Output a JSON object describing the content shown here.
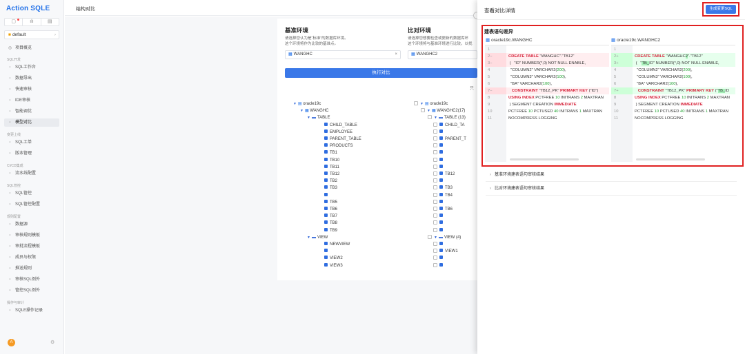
{
  "app": {
    "brand": "Action SQLE"
  },
  "header": {
    "title": "结构对比"
  },
  "sidebar": {
    "toptabs": [
      "▢",
      "ılı",
      "▤"
    ],
    "datasource": "default",
    "sections": [
      {
        "label": "SQL开发",
        "items": [
          {
            "label": "SQL工作台",
            "icon": "terminal-icon"
          },
          {
            "label": "数据导出",
            "icon": "export-icon"
          },
          {
            "label": "快速审核",
            "icon": "audit-icon"
          },
          {
            "label": "IDE审核",
            "icon": "ide-icon"
          },
          {
            "label": "智能调优",
            "icon": "tune-icon"
          },
          {
            "label": "模型对比",
            "icon": "compare-icon",
            "active": true
          }
        ]
      },
      {
        "label": "变更上线",
        "items": [
          {
            "label": "SQL工单",
            "icon": "ticket-icon"
          },
          {
            "label": "版本管理",
            "icon": "version-icon"
          }
        ]
      },
      {
        "label": "CI/CD集成",
        "items": [
          {
            "label": "流水线配置",
            "icon": "pipeline-icon"
          }
        ]
      },
      {
        "label": "SQL管控",
        "items": [
          {
            "label": "SQL管控",
            "icon": "control-icon"
          },
          {
            "label": "SQL管控配置",
            "icon": "config-icon"
          }
        ]
      },
      {
        "label": "规则配置",
        "items": [
          {
            "label": "数据源",
            "icon": "database-icon"
          },
          {
            "label": "审核规则模板",
            "icon": "rule-icon"
          },
          {
            "label": "审批流程模板",
            "icon": "flow-icon"
          },
          {
            "label": "成员与权限",
            "icon": "member-icon"
          },
          {
            "label": "推送规则",
            "icon": "push-icon"
          },
          {
            "label": "审核SQL例外",
            "icon": "exception-icon"
          },
          {
            "label": "管控SQL例外",
            "icon": "shield-icon"
          }
        ]
      },
      {
        "label": "操作与审计",
        "items": [
          {
            "label": "SQLE操作记录",
            "icon": "record-icon"
          }
        ]
      }
    ],
    "avatar": "A"
  },
  "main": {
    "base": {
      "title": "基准环境",
      "desc1": "请选择您认为是“标准”的数据库环境。",
      "desc2": "这个环境将作为比较的基准点。",
      "value": "WANGHC",
      "clear": "×"
    },
    "compare": {
      "title": "比对环境",
      "desc1": "请选择您想要检查或更新的数据库环",
      "desc2": "这个环境将与基准环境进行比较，以找",
      "value": "WANGHC2"
    },
    "run_label": "执行对比",
    "filter": "只",
    "tree_left": [
      {
        "text": "oracle19c",
        "kind": "inst"
      },
      {
        "text": "WANGHC",
        "kind": "db"
      },
      {
        "text": "TABLE",
        "kind": "folder"
      },
      {
        "text": "CHILD_TABLE",
        "kind": "t"
      },
      {
        "text": "EMPLOYEE",
        "kind": "t"
      },
      {
        "text": "PARENT_TABLE",
        "kind": "t"
      },
      {
        "text": "PRODUCTS",
        "kind": "t"
      },
      {
        "text": "TB1",
        "kind": "t"
      },
      {
        "text": "TB10",
        "kind": "t"
      },
      {
        "text": "TB11",
        "kind": "t"
      },
      {
        "text": "TB12",
        "kind": "t"
      },
      {
        "text": "TB2",
        "kind": "t"
      },
      {
        "text": "TB3",
        "kind": "t"
      },
      {
        "text": "",
        "kind": "t"
      },
      {
        "text": "TB5",
        "kind": "t"
      },
      {
        "text": "TB6",
        "kind": "t"
      },
      {
        "text": "TB7",
        "kind": "t"
      },
      {
        "text": "TB8",
        "kind": "t"
      },
      {
        "text": "TB9",
        "kind": "t"
      },
      {
        "text": "VIEW",
        "kind": "folder"
      },
      {
        "text": "NEWVIEW",
        "kind": "v"
      },
      {
        "text": "",
        "kind": "v"
      },
      {
        "text": "VIEW2",
        "kind": "v"
      },
      {
        "text": "VIEW3",
        "kind": "v"
      }
    ],
    "tree_right": [
      {
        "text": "oracle19c",
        "kind": "inst"
      },
      {
        "text": "WANGHC2(17)",
        "kind": "db"
      },
      {
        "text": "TABLE (13)",
        "kind": "folder"
      },
      {
        "text": "CHILD_TA",
        "kind": "t"
      },
      {
        "text": "",
        "kind": "t"
      },
      {
        "text": "PARENT_T",
        "kind": "t"
      },
      {
        "text": "",
        "kind": "t"
      },
      {
        "text": "",
        "kind": "t"
      },
      {
        "text": "",
        "kind": "t"
      },
      {
        "text": "",
        "kind": "t"
      },
      {
        "text": "TB12",
        "kind": "t"
      },
      {
        "text": "",
        "kind": "t"
      },
      {
        "text": "TB3",
        "kind": "t"
      },
      {
        "text": "TB4",
        "kind": "t"
      },
      {
        "text": "",
        "kind": "t"
      },
      {
        "text": "TB6",
        "kind": "t"
      },
      {
        "text": "",
        "kind": "t"
      },
      {
        "text": "",
        "kind": "t"
      },
      {
        "text": "",
        "kind": "t"
      },
      {
        "text": "VIEW (4)",
        "kind": "folder"
      },
      {
        "text": "",
        "kind": "v"
      },
      {
        "text": "VIEW1",
        "kind": "v"
      },
      {
        "text": "",
        "kind": "v"
      },
      {
        "text": "",
        "kind": "v"
      }
    ]
  },
  "drawer": {
    "title": "查看对比详情",
    "gen_button": "生成变更SQL",
    "diff_title": "建表语句差异",
    "left_header": "oracle19c.WANGHC",
    "right_header": "oracle19c.WANGHC2",
    "accordions": [
      "基准环境建表语句审核结果",
      "比对环境建表语句审核结果"
    ]
  }
}
